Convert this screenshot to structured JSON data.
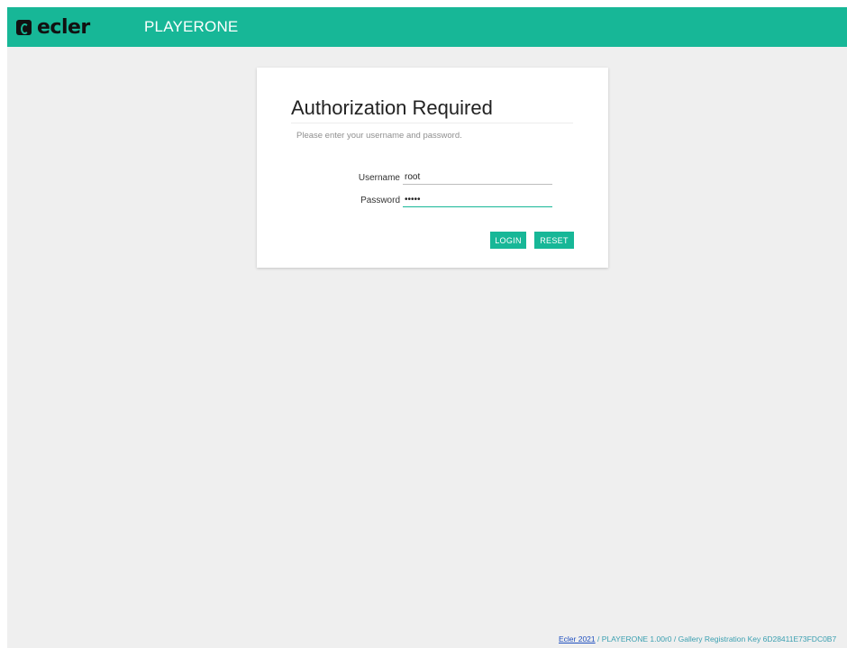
{
  "header": {
    "logo_text": "ecler",
    "app_title": "PLAYERONE",
    "brand_color": "#17b797"
  },
  "login_card": {
    "title": "Authorization Required",
    "subtitle": "Please enter your username and password.",
    "username_label": "Username",
    "username_value": "root",
    "password_label": "Password",
    "password_value": "•••••",
    "login_label": "LOGIN",
    "reset_label": "RESET"
  },
  "footer": {
    "link_text": "Ecler 2021",
    "info_text": " / PLAYERONE 1.00r0 / Gallery Registration Key 6D28411E73FDC0B7"
  }
}
